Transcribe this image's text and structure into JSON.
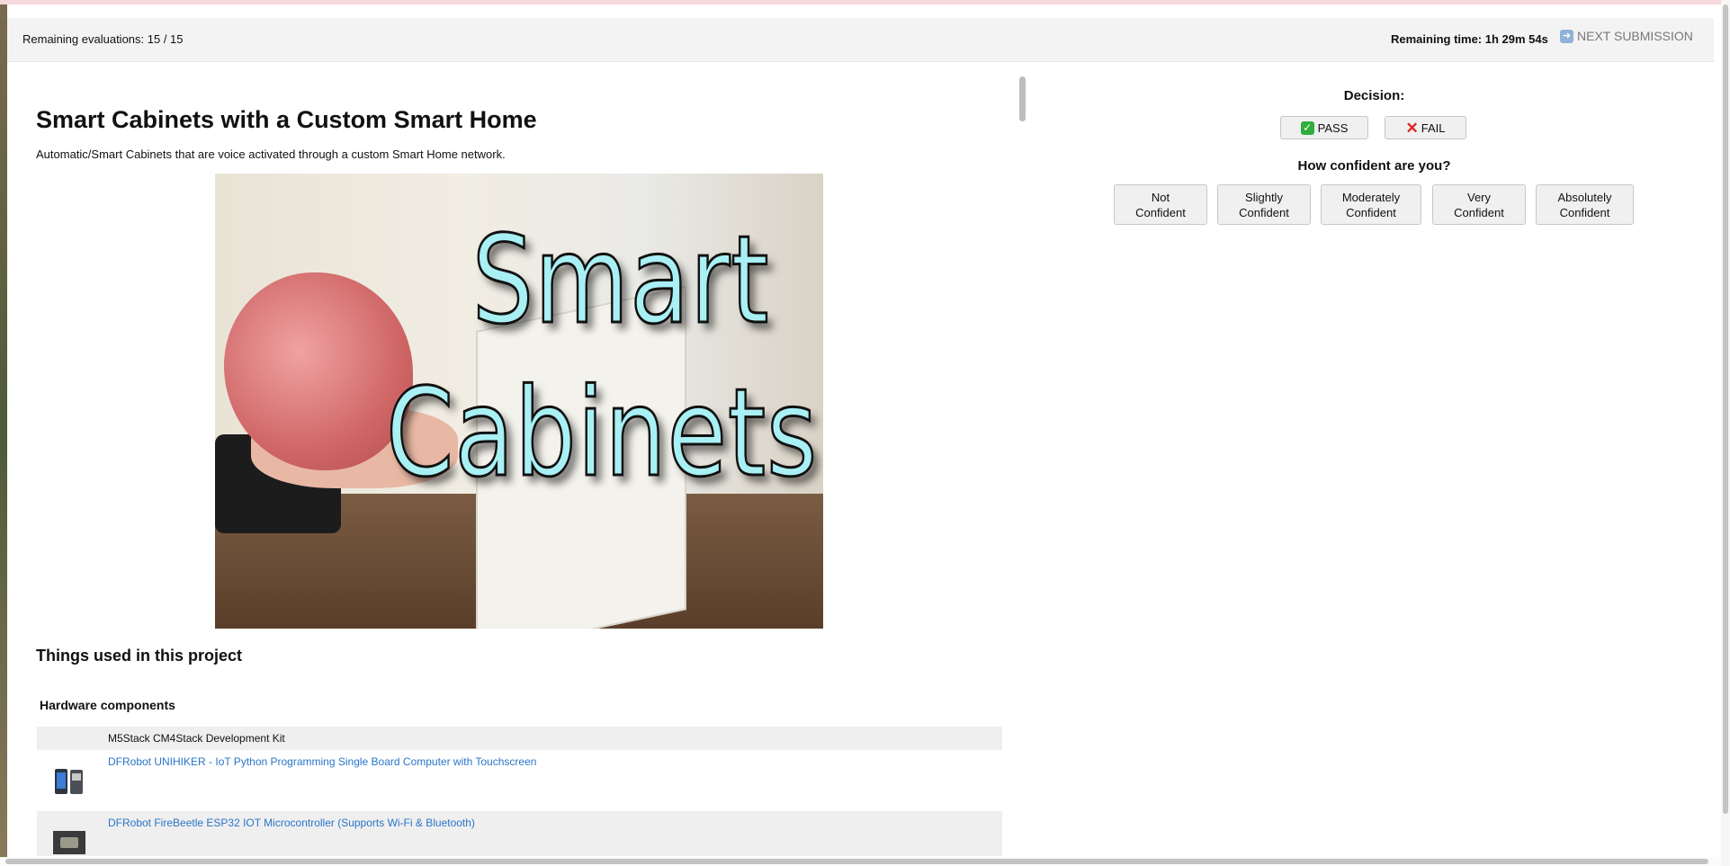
{
  "header": {
    "remaining_evaluations": "Remaining evaluations: 15 / 15",
    "remaining_time": "Remaining time: 1h 29m 54s",
    "next_submission": "NEXT SUBMISSION",
    "next_icon": "arrow-right-icon"
  },
  "project": {
    "title": "Smart Cabinets with a Custom Smart Home",
    "description": "Automatic/Smart Cabinets that are voice activated through a custom Smart Home network.",
    "image_text_line1": "Smart",
    "image_text_line2": "Cabinets"
  },
  "things": {
    "section_title": "Things used in this project",
    "hardware_title": "Hardware components",
    "components": [
      {
        "name": "M5Stack CM4Stack Development Kit",
        "is_link": false
      },
      {
        "name": "DFRobot UNIHIKER - IoT Python Programming Single Board Computer with Touchscreen",
        "is_link": true
      },
      {
        "name": "DFRobot FireBeetle ESP32 IOT Microcontroller (Supports Wi-Fi & Bluetooth)",
        "is_link": true
      }
    ]
  },
  "decision": {
    "label": "Decision:",
    "pass": "PASS",
    "fail": "FAIL",
    "confidence_label": "How confident are you?",
    "confidence_options": {
      "not": [
        "Not",
        "Confident"
      ],
      "slightly": [
        "Slightly",
        "Confident"
      ],
      "moderately": [
        "Moderately",
        "Confident"
      ],
      "very": [
        "Very",
        "Confident"
      ],
      "absolutely": [
        "Absolutely",
        "Confident"
      ]
    }
  },
  "colors": {
    "link": "#2a75c8",
    "pass_icon": "#2fae3b",
    "fail_icon": "#e02424",
    "image_text": "#a8f0f4"
  }
}
